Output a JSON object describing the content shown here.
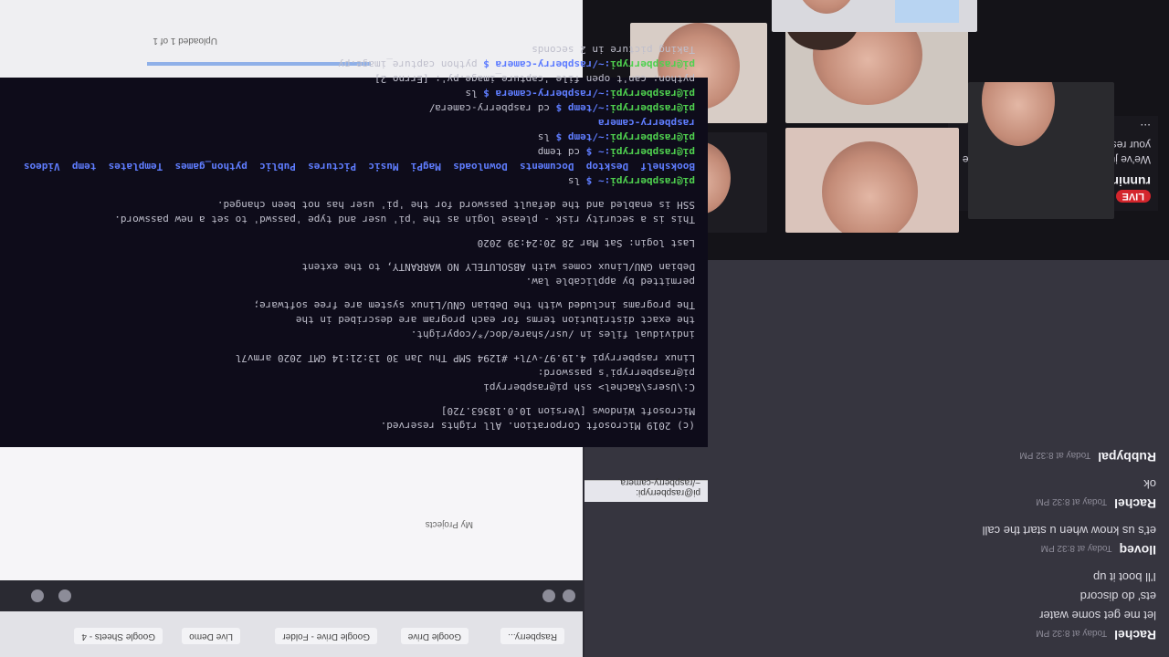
{
  "chat": {
    "messages": [
      {
        "author": "Rachel",
        "time": "Today at 8:32 PM",
        "lines": [
          "let me get some water",
          "ets' do discord",
          "I'll boot it up"
        ]
      },
      {
        "author": "Iloveq",
        "time": "Today at 8:32 PM",
        "lines": [
          "et's us know when u start the call"
        ]
      },
      {
        "author": "Rachel",
        "time": "Today at 8:32 PM",
        "lines": [
          "ok"
        ]
      },
      {
        "author": "Rubbypal",
        "time": "Today at 8:32 PM",
        "lines": []
      }
    ]
  },
  "stream": {
    "live_badge": "LIVE",
    "title": "Your stream is still running!",
    "body": "We've just paused this preview to save your resources.",
    "more": "..."
  },
  "terminal": {
    "lines": [
      {
        "prompt": "",
        "path": "",
        "text": "Taking picture in 2 seconds"
      },
      {
        "prompt": "pi@raspberrypi",
        "path": ":~/raspberry-camera $",
        "text": " python capture_image.py"
      },
      {
        "prompt": "",
        "path": "",
        "text": "python: can't open file 'capture_image.py': [Errno 2]"
      },
      {
        "prompt": "pi@raspberrypi",
        "path": ":~/raspberry-camera $",
        "text": " ls"
      },
      {
        "prompt": "pi@raspberrypi",
        "path": ":~/temp $",
        "text": " cd raspberry-camera/"
      },
      {
        "prompt": "",
        "path": "",
        "dir": "raspberry-camera"
      },
      {
        "prompt": "pi@raspberrypi",
        "path": ":~/temp $",
        "text": " ls"
      },
      {
        "prompt": "pi@raspberrypi",
        "path": ":~ $",
        "text": " cd temp"
      },
      {
        "prompt": "",
        "path": "",
        "dirs": "Bookshelf  Desktop  Documents  Downloads  MagPi  Music  Pictures  Public  python_games  Templates  temp  Videos"
      },
      {
        "prompt": "pi@raspberrypi",
        "path": ":~ $",
        "text": " ls"
      },
      {
        "gap": true
      },
      {
        "prompt": "",
        "path": "",
        "text": "SSH is enabled and the default password for the 'pi' user has not been changed."
      },
      {
        "prompt": "",
        "path": "",
        "text": "This is a security risk - please login as the 'pi' user and type 'passwd' to set a new password."
      },
      {
        "gap": true
      },
      {
        "prompt": "",
        "path": "",
        "text": "Last login: Sat Mar 28 20:24:39 2020"
      },
      {
        "gap": true
      },
      {
        "prompt": "",
        "path": "",
        "text": "Debian GNU/Linux comes with ABSOLUTELY NO WARRANTY, to the extent"
      },
      {
        "prompt": "",
        "path": "",
        "text": "permitted by applicable law."
      },
      {
        "gap": true
      },
      {
        "prompt": "",
        "path": "",
        "text": "The programs included with the Debian GNU/Linux system are free software;"
      },
      {
        "prompt": "",
        "path": "",
        "text": "the exact distribution terms for each program are described in the"
      },
      {
        "prompt": "",
        "path": "",
        "text": "individual files in /usr/share/doc/*/copyright."
      },
      {
        "gap": true
      },
      {
        "prompt": "",
        "path": "",
        "text": "Linux raspberrypi 4.19.97-v7l+ #1294 SMP Thu Jan 30 13:21:14 GMT 2020 armv7l"
      },
      {
        "prompt": "",
        "path": "",
        "text": "pi@raspberrypi's password:"
      },
      {
        "prompt": "",
        "path": "",
        "text": "C:\\Users\\Rachel> ssh pi@raspberrypi"
      },
      {
        "gap": true
      },
      {
        "prompt": "",
        "path": "",
        "text": "Microsoft Windows [Version 10.0.18363.720]"
      },
      {
        "prompt": "",
        "path": "",
        "text": "(c) 2019 Microsoft Corporation. All rights reserved."
      }
    ]
  },
  "terminal_window": {
    "title": "pi@raspberrypi: ~/raspberry-camera"
  },
  "browser": {
    "tabs": [
      "Raspberry...",
      "Google Drive",
      "Google Drive - Folder",
      "Live Demo",
      "Google Sheets - 4"
    ],
    "folder_tab": "My Projects",
    "footer": "Uploaded 1 of 1"
  }
}
